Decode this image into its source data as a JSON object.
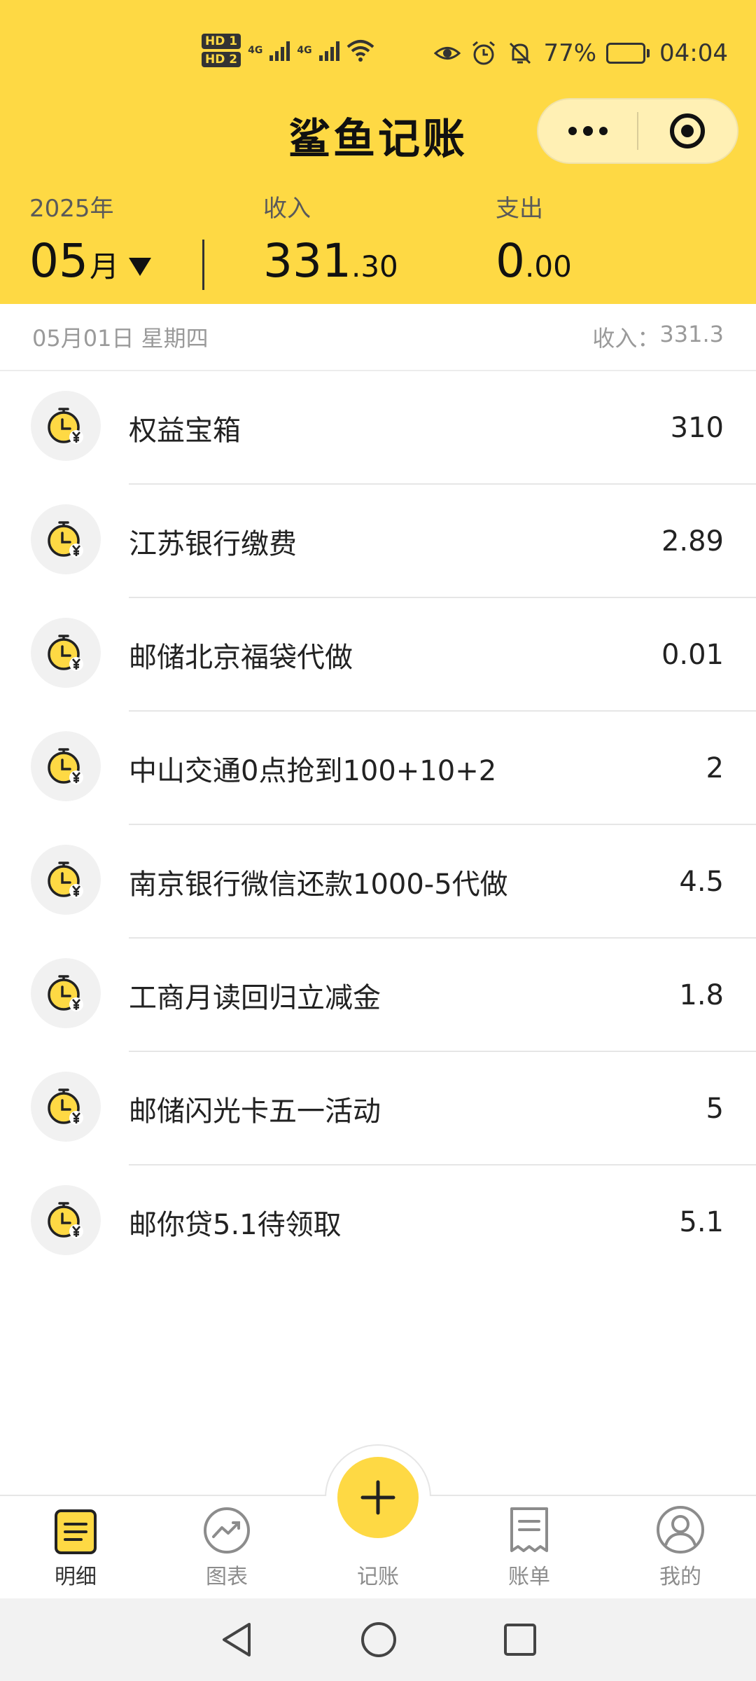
{
  "status_bar": {
    "hd1": "HD 1",
    "hd2": "HD 2",
    "sig1": "4G",
    "sig2": "4G",
    "battery_pct": "77%",
    "battery_level": 0.77,
    "time": "04:04"
  },
  "header": {
    "app_title": "鲨鱼记账",
    "year": "2025年",
    "month_num": "05",
    "month_unit": "月",
    "income_label": "收入",
    "income_int": "331",
    "income_dec": ".30",
    "expense_label": "支出",
    "expense_int": "0",
    "expense_dec": ".00"
  },
  "day": {
    "date": "05月01日 星期四",
    "income_label": "收入：",
    "income_value": "331.3"
  },
  "transactions": [
    {
      "title": "权益宝箱",
      "amount": "310"
    },
    {
      "title": "江苏银行缴费",
      "amount": "2.89"
    },
    {
      "title": "邮储北京福袋代做",
      "amount": "0.01"
    },
    {
      "title": "中山交通0点抢到100+10+2",
      "amount": "2"
    },
    {
      "title": "南京银行微信还款1000-5代做",
      "amount": "4.5"
    },
    {
      "title": "工商月读回归立减金",
      "amount": "1.8"
    },
    {
      "title": "邮储闪光卡五一活动",
      "amount": "5"
    },
    {
      "title": "邮你贷5.1待领取",
      "amount": "5.1"
    }
  ],
  "tabs": {
    "detail": "明细",
    "chart": "图表",
    "add": "记账",
    "bill": "账单",
    "me": "我的"
  },
  "colors": {
    "accent": "#FED944",
    "text": "#222222",
    "muted": "#9a9a9a"
  },
  "icons": {
    "transaction": "clock-yen-icon",
    "detail": "list-doc-icon",
    "chart": "trend-chart-icon",
    "add": "plus-icon",
    "bill": "receipt-icon",
    "me": "user-circle-icon"
  }
}
